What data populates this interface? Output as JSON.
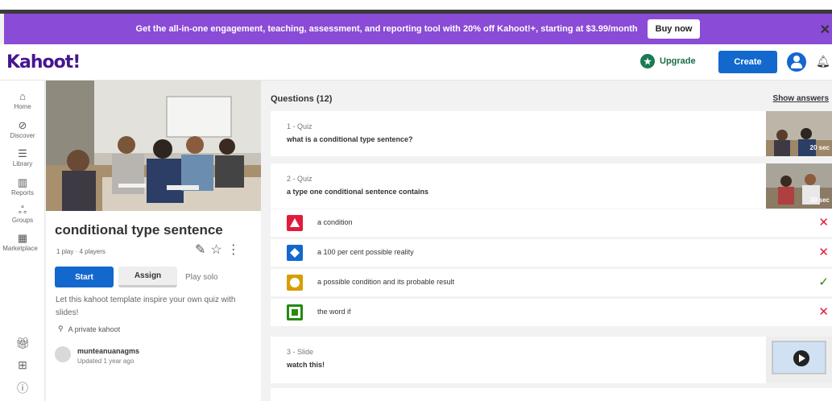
{
  "banner": {
    "text": "Get the all-in-one engagement, teaching, assessment, and reporting tool with 20% off Kahoot!+, starting at $3.99/month",
    "buy_label": "Buy now",
    "close_icon": "close-icon"
  },
  "header": {
    "logo": "Kahoot!",
    "upgrade_label": "Upgrade",
    "create_label": "Create"
  },
  "sidebar": {
    "items": [
      {
        "label": "Home",
        "icon": "home-icon"
      },
      {
        "label": "Discover",
        "icon": "compass-icon"
      },
      {
        "label": "Library",
        "icon": "list-icon"
      },
      {
        "label": "Reports",
        "icon": "bar-chart-icon"
      },
      {
        "label": "Groups",
        "icon": "groups-icon"
      },
      {
        "label": "Marketplace",
        "icon": "store-icon"
      }
    ]
  },
  "kahoot": {
    "title": "conditional type sentence",
    "plays": "1 play · 4 players",
    "start_label": "Start",
    "assign_label": "Assign",
    "play_solo_label": "Play solo",
    "description": "Let this kahoot template inspire your own quiz with slides!",
    "visibility": "A private kahoot",
    "creator": "munteanuanagms",
    "updated": "Updated 1 year ago"
  },
  "questions": {
    "header": "Questions (12)",
    "show_answers": "Show answers",
    "items": [
      {
        "type": "1 - Quiz",
        "text": "what is a conditional type sentence?",
        "time": "20 sec"
      },
      {
        "type": "2 - Quiz",
        "text": "a type one conditional sentence contains",
        "time": "30 sec"
      },
      {
        "type": "3 - Slide",
        "text": "watch this!"
      }
    ],
    "answers": [
      {
        "text": "a condition",
        "color": "#e21b3c",
        "correct": false
      },
      {
        "text": "a 100 per cent possible reality",
        "color": "#1368ce",
        "correct": false
      },
      {
        "text": "a possible condition and its probable result",
        "color": "#d89e00",
        "correct": true
      },
      {
        "text": "the word if",
        "color": "#26890c",
        "correct": false
      }
    ]
  }
}
